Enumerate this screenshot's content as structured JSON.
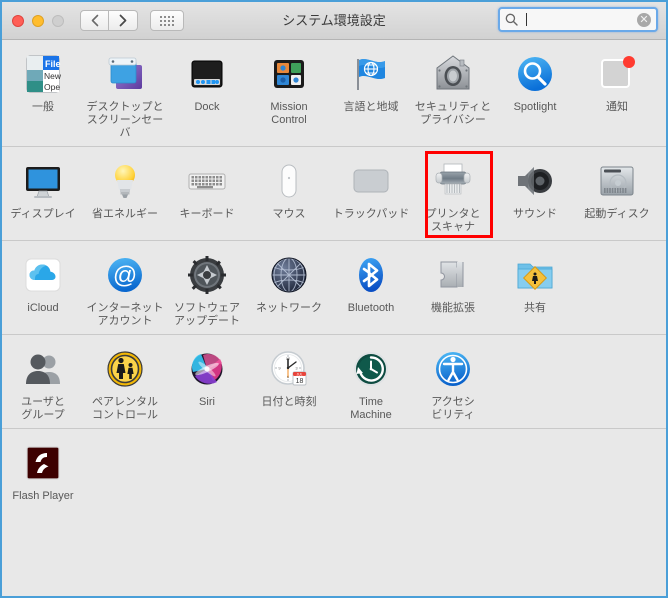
{
  "window": {
    "title": "システム環境設定",
    "accent_blue": "#4a9fd8",
    "highlight_color": "#ff0000",
    "background": "#e8e8e8"
  },
  "titlebar": {
    "close_label": "",
    "minimize_label": "",
    "zoom_label": "",
    "back_glyph": "‹",
    "forward_glyph": "›",
    "grid_button_name": "すべてを表示"
  },
  "search": {
    "value": "",
    "placeholder": "",
    "clear_glyph": "✕"
  },
  "rows": [
    {
      "panes": [
        {
          "label": "一般",
          "icon": "general-icon"
        },
        {
          "label": "デスクトップと\nスクリーンセーバ",
          "icon": "desktop-screensaver-icon"
        },
        {
          "label": "Dock",
          "icon": "dock-icon"
        },
        {
          "label": "Mission\nControl",
          "icon": "mission-control-icon"
        },
        {
          "label": "言語と地域",
          "icon": "language-region-icon"
        },
        {
          "label": "セキュリティと\nプライバシー",
          "icon": "security-privacy-icon"
        },
        {
          "label": "Spotlight",
          "icon": "spotlight-icon"
        },
        {
          "label": "通知",
          "icon": "notifications-icon",
          "badge": true
        }
      ]
    },
    {
      "panes": [
        {
          "label": "ディスプレイ",
          "icon": "displays-icon"
        },
        {
          "label": "省エネルギー",
          "icon": "energy-saver-icon"
        },
        {
          "label": "キーボード",
          "icon": "keyboard-icon"
        },
        {
          "label": "マウス",
          "icon": "mouse-icon"
        },
        {
          "label": "トラックパッド",
          "icon": "trackpad-icon"
        },
        {
          "label": "プリンタと\nスキャナ",
          "icon": "printers-scanners-icon",
          "highlighted": true
        },
        {
          "label": "サウンド",
          "icon": "sound-icon"
        },
        {
          "label": "起動ディスク",
          "icon": "startup-disk-icon"
        }
      ]
    },
    {
      "panes": [
        {
          "label": "iCloud",
          "icon": "icloud-icon"
        },
        {
          "label": "インターネット\nアカウント",
          "icon": "internet-accounts-icon"
        },
        {
          "label": "ソフトウェア\nアップデート",
          "icon": "software-update-icon"
        },
        {
          "label": "ネットワーク",
          "icon": "network-icon"
        },
        {
          "label": "Bluetooth",
          "icon": "bluetooth-icon"
        },
        {
          "label": "機能拡張",
          "icon": "extensions-icon"
        },
        {
          "label": "共有",
          "icon": "sharing-icon"
        }
      ]
    },
    {
      "panes": [
        {
          "label": "ユーザと\nグループ",
          "icon": "users-groups-icon"
        },
        {
          "label": "ペアレンタル\nコントロール",
          "icon": "parental-controls-icon"
        },
        {
          "label": "Siri",
          "icon": "siri-icon"
        },
        {
          "label": "日付と時刻",
          "icon": "date-time-icon"
        },
        {
          "label": "Time\nMachine",
          "icon": "time-machine-icon"
        },
        {
          "label": "アクセシ\nビリティ",
          "icon": "accessibility-icon"
        }
      ]
    },
    {
      "panes": [
        {
          "label": "Flash Player",
          "icon": "flash-player-icon"
        }
      ]
    }
  ]
}
